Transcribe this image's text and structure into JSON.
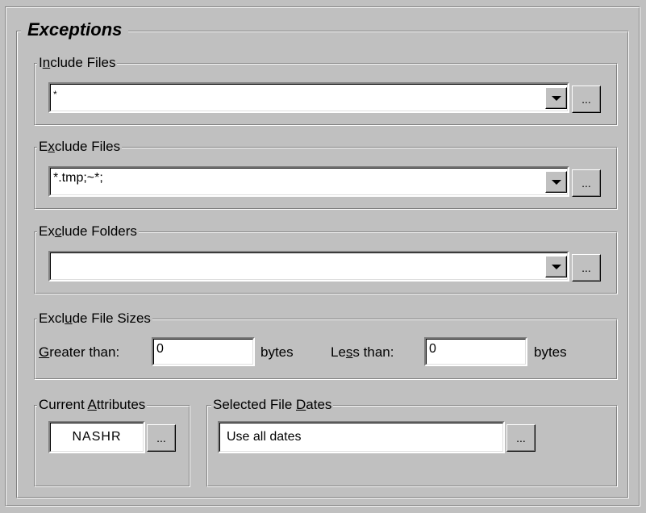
{
  "panel": {
    "title": "Exceptions"
  },
  "include_files": {
    "label_pre": "I",
    "label_accel": "n",
    "label_post": "clude Files",
    "value": "*",
    "browse_label": "..."
  },
  "exclude_files": {
    "label_pre": "E",
    "label_accel": "x",
    "label_post": "clude Files",
    "value": "*.tmp;~*;",
    "browse_label": "..."
  },
  "exclude_folders": {
    "label_pre": "Ex",
    "label_accel": "c",
    "label_post": "lude Folders",
    "value": "",
    "browse_label": "..."
  },
  "exclude_sizes": {
    "label_pre": "Excl",
    "label_accel": "u",
    "label_post": "de File Sizes",
    "greater_accel": "G",
    "greater_post": "reater than:",
    "greater_value": "0",
    "greater_unit": "bytes",
    "less_pre": "Le",
    "less_accel": "s",
    "less_post": "s than:",
    "less_value": "0",
    "less_unit": "bytes"
  },
  "attributes": {
    "label_pre": "Current ",
    "label_accel": "A",
    "label_post": "ttributes",
    "value": "NASHR",
    "browse_label": "..."
  },
  "dates": {
    "label_pre": "Selected File ",
    "label_accel": "D",
    "label_post": "ates",
    "value": "Use all dates",
    "browse_label": "..."
  }
}
